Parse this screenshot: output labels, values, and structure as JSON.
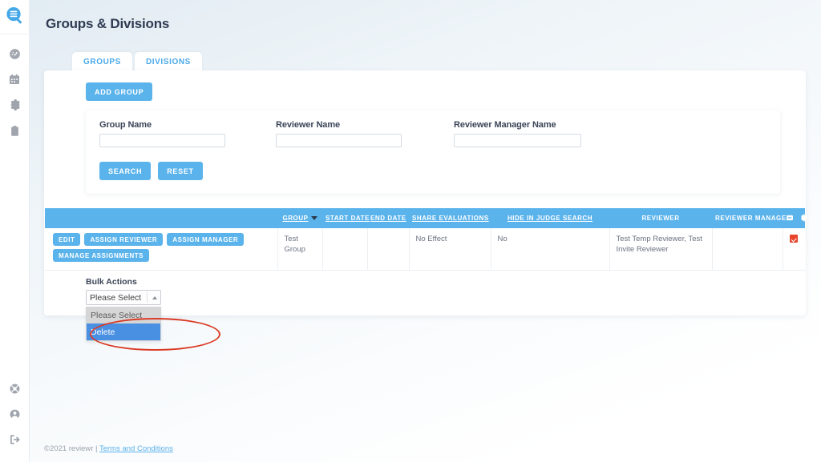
{
  "sidebar": {
    "logo": "reviewr-logo-icon",
    "top_items": [
      {
        "name": "dashboard",
        "icon": "gauge-icon"
      },
      {
        "name": "calendar",
        "icon": "calendar-icon"
      },
      {
        "name": "settings",
        "icon": "gear-icon"
      },
      {
        "name": "clipboard",
        "icon": "clipboard-icon"
      }
    ],
    "bottom_items": [
      {
        "name": "help",
        "icon": "lifebuoy-icon"
      },
      {
        "name": "account",
        "icon": "user-circle-icon"
      },
      {
        "name": "logout",
        "icon": "logout-icon"
      }
    ]
  },
  "header": {
    "title": "Groups & Divisions"
  },
  "tabs": [
    {
      "label": "GROUPS",
      "active": true
    },
    {
      "label": "DIVISIONS",
      "active": false
    }
  ],
  "toolbar": {
    "add_group_label": "ADD GROUP"
  },
  "search": {
    "group_name_label": "Group Name",
    "group_name_value": "",
    "reviewer_name_label": "Reviewer Name",
    "reviewer_name_value": "",
    "reviewer_manager_label": "Reviewer Manager Name",
    "reviewer_manager_value": "",
    "search_label": "SEARCH",
    "reset_label": "RESET"
  },
  "table": {
    "headers": {
      "actions": "",
      "group": "GROUP",
      "start_date": "START DATE",
      "end_date": "END DATE",
      "share_evaluations": "SHARE EVALUATIONS",
      "hide_in_judge_search": "HIDE IN JUDGE SEARCH",
      "reviewer": "REVIEWER",
      "reviewer_manager": "REVIEWER MANAGER"
    },
    "sort_column": "GROUP",
    "sort_direction": "desc",
    "header_icons": [
      "minus-box-icon",
      "gear-icon"
    ],
    "rows": [
      {
        "actions": [
          "EDIT",
          "ASSIGN REVIEWER",
          "ASSIGN MANAGER",
          "MANAGE ASSIGNMENTS"
        ],
        "group": "Test Group",
        "start_date": "",
        "end_date": "",
        "share_evaluations": "No Effect",
        "hide_in_judge_search": "No",
        "reviewer": "Test Temp Reviewer, Test Invite Reviewer",
        "reviewer_manager": "",
        "selected": true
      }
    ]
  },
  "bulk_actions": {
    "label": "Bulk Actions",
    "selected_value": "Please Select",
    "options": [
      {
        "label": "Please Select",
        "state": "highlighted"
      },
      {
        "label": "Delete",
        "state": "selected"
      }
    ],
    "annotation": {
      "shape": "ellipse",
      "color": "#d93b26",
      "around": "Delete"
    }
  },
  "footer": {
    "copyright": "©2021 reviewr |",
    "link": "Terms and Conditions"
  },
  "colors": {
    "accent": "#5bb3ec",
    "title": "#2f3b52",
    "danger": "#e8452c",
    "dropdown_selected": "#4a90e2"
  }
}
